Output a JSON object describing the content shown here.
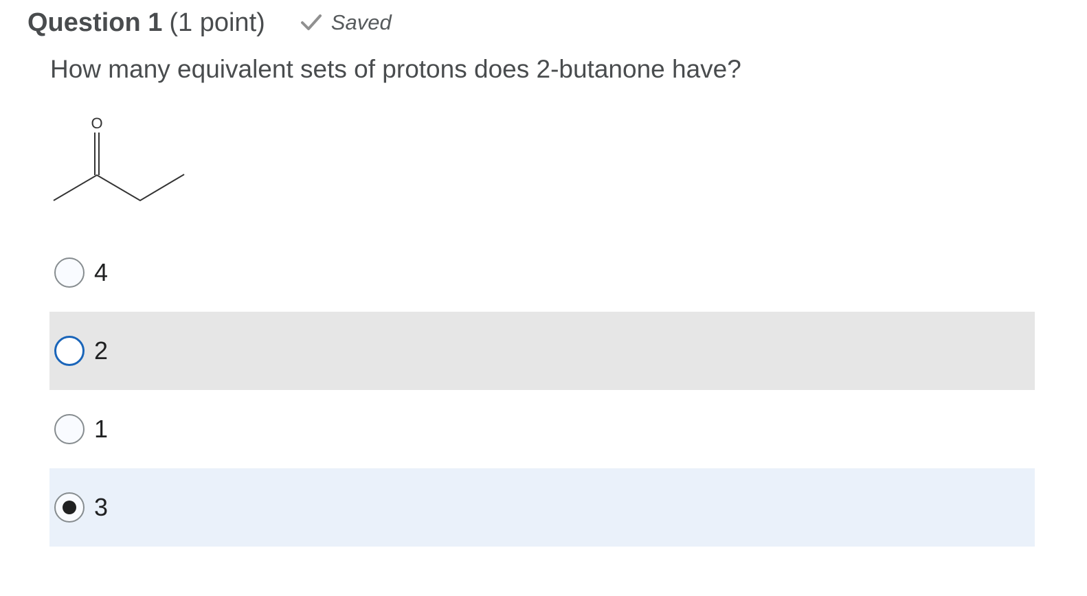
{
  "header": {
    "title": "Question 1",
    "points": "(1 point)",
    "status_icon": "check-icon",
    "status_text": "Saved"
  },
  "question": {
    "text": "How many equivalent sets of protons does 2-butanone have?",
    "structure_atom_label": "O"
  },
  "options": [
    {
      "label": "4",
      "state": "default"
    },
    {
      "label": "2",
      "state": "hover-focus"
    },
    {
      "label": "1",
      "state": "default"
    },
    {
      "label": "3",
      "state": "selected"
    }
  ],
  "colors": {
    "text": "#494c4e",
    "hover_row": "#e6e6e6",
    "selected_row": "#eaf1fa",
    "focus_ring": "#1a65b9",
    "check": "#909090"
  }
}
